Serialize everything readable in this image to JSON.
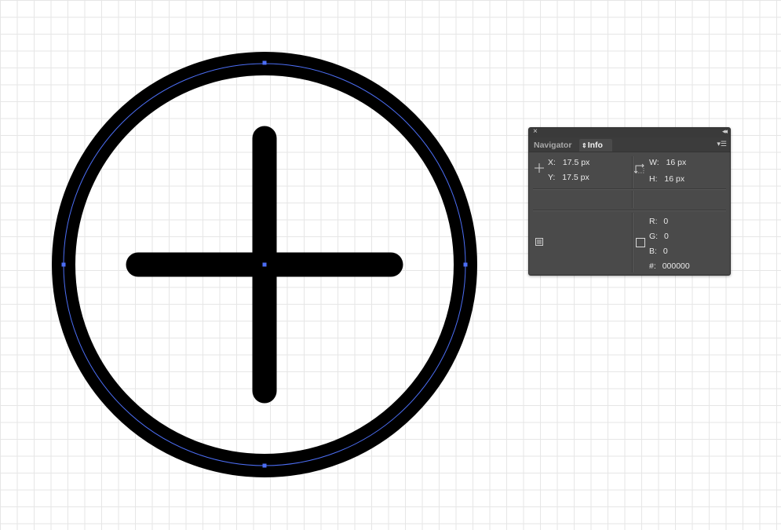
{
  "panel": {
    "close_glyph": "×",
    "collapse_glyph": "◂◂",
    "tabs": [
      {
        "label": "Navigator",
        "active": false
      },
      {
        "label": "Info",
        "active": true
      }
    ],
    "menu_glyph": "▾☰",
    "position": {
      "x_label": "X:",
      "x_value": "17.5 px",
      "y_label": "Y:",
      "y_value": "17.5 px"
    },
    "size": {
      "w_label": "W:",
      "w_value": "16 px",
      "h_label": "H:",
      "h_value": "16 px"
    },
    "color": {
      "r_label": "R:",
      "r_value": "0",
      "g_label": "G:",
      "g_value": "0",
      "b_label": "B:",
      "b_value": "0",
      "hex_label": "#:",
      "hex_value": "000000"
    },
    "icons": {
      "crosshair": "crosshair-icon",
      "size": "size-frame-icon",
      "fill": "fill-swatch-icon",
      "stroke": "stroke-swatch-icon"
    }
  },
  "artwork": {
    "description_shape": "plus-in-circle",
    "stroke_color": "#000000",
    "selection_color": "#4c6ef5"
  }
}
